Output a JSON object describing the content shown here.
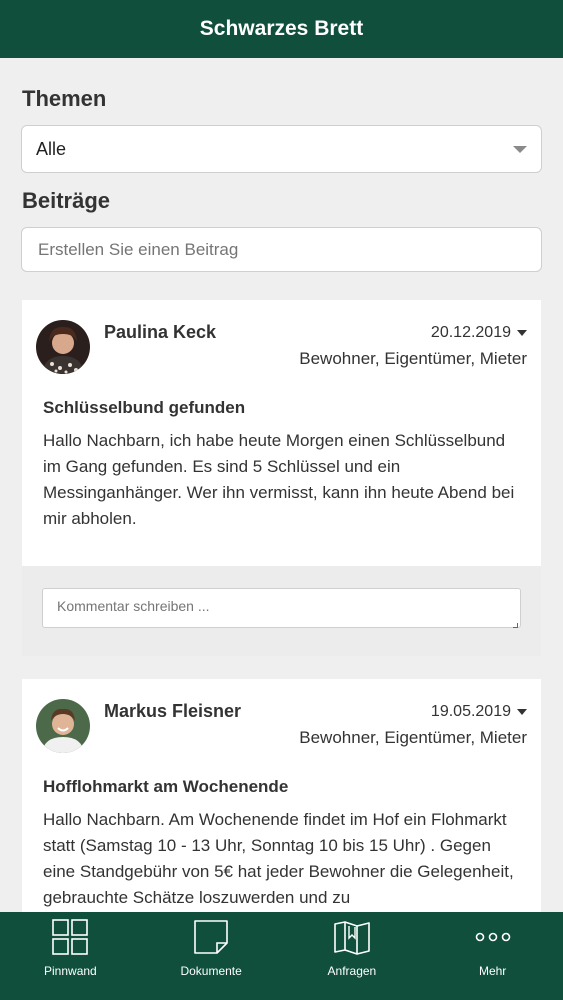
{
  "header": {
    "title": "Schwarzes Brett"
  },
  "themes": {
    "heading": "Themen",
    "selected": "Alle"
  },
  "posts_section": {
    "heading": "Beiträge",
    "compose_placeholder": "Erstellen Sie einen Beitrag"
  },
  "posts": [
    {
      "author": "Paulina Keck",
      "date": "20.12.2019",
      "audience": "Bewohner, Eigentümer, Mieter",
      "title": "Schlüsselbund gefunden",
      "body": "Hallo Nachbarn, ich habe heute Morgen einen Schlüsselbund im Gang gefunden. Es sind 5 Schlüssel und ein Messinganhänger. Wer ihn vermisst, kann ihn heute Abend bei mir abholen.",
      "comment_placeholder": "Kommentar schreiben ..."
    },
    {
      "author": "Markus Fleisner",
      "date": "19.05.2019",
      "audience": "Bewohner, Eigentümer, Mieter",
      "title": "Hofflohmarkt am Wochenende",
      "body": "Hallo Nachbarn. Am Wochenende findet im Hof ein Flohmarkt statt (Samstag 10 - 13 Uhr, Sonntag 10 bis 15 Uhr) . Gegen eine Standgebühr von 5€ hat jeder Bewohner die Gelegenheit, gebrauchte Schätze loszuwerden und zu"
    }
  ],
  "tabbar": {
    "items": [
      {
        "label": "Pinnwand",
        "icon": "grid-icon"
      },
      {
        "label": "Dokumente",
        "icon": "document-icon"
      },
      {
        "label": "Anfragen",
        "icon": "book-icon"
      },
      {
        "label": "Mehr",
        "icon": "more-icon"
      }
    ]
  },
  "colors": {
    "primary": "#0f4f3c",
    "background": "#efefef"
  }
}
